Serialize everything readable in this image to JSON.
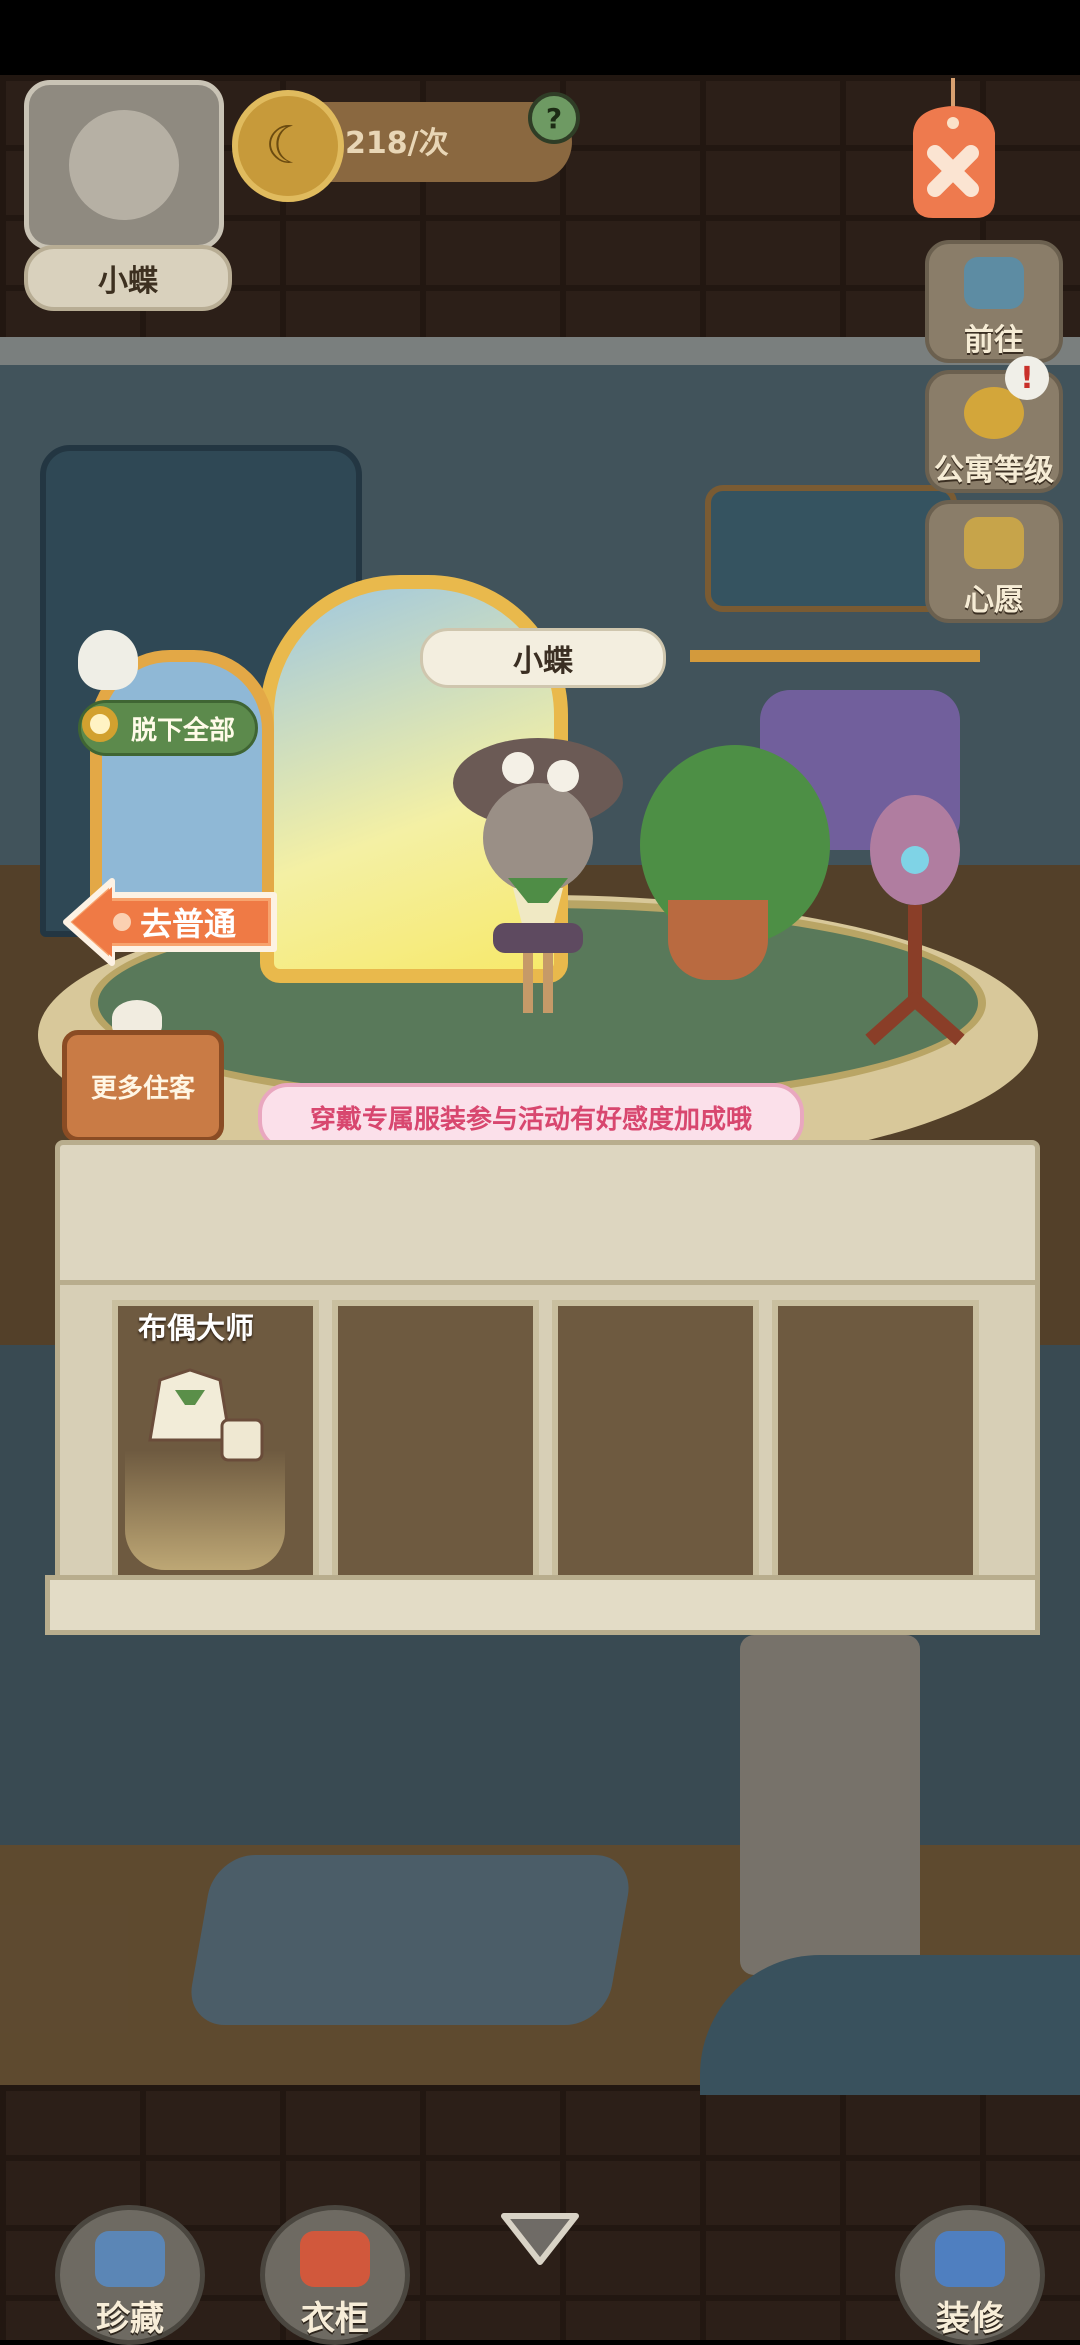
{
  "header": {
    "character_name": "小蝶",
    "banana_rate": "218/次",
    "help_icon": "question-icon"
  },
  "side_menu": [
    {
      "label": "前往",
      "icon": "map-pin-icon"
    },
    {
      "label": "公寓等级",
      "icon": "apartment-level-icon",
      "alert": "!"
    },
    {
      "label": "心愿",
      "icon": "wish-heart-icon"
    }
  ],
  "stage": {
    "name_tag": "小蝶",
    "undress_label": "脱下全部",
    "go_normal_label": "去普通",
    "more_guests_label": "更多住客",
    "hint": "穿戴专属服装参与活动有好感度加成哦"
  },
  "outfits": [
    {
      "label": "布偶大师"
    }
  ],
  "bottom_bar": [
    {
      "label": "珍藏",
      "icon": "collection-icon"
    },
    {
      "label": "衣柜",
      "icon": "wardrobe-icon"
    },
    {
      "label": "装修",
      "icon": "paint-brush-icon"
    }
  ],
  "colors": {
    "accent_orange": "#ef7a45",
    "hint_pink": "#d8476f",
    "button_green": "#5c8a4c"
  }
}
